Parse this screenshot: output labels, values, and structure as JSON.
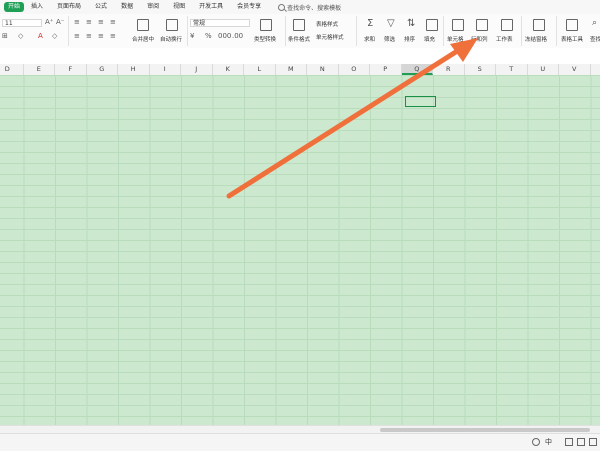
{
  "menu": {
    "active": "开始",
    "items": [
      "插入",
      "页面布局",
      "公式",
      "数据",
      "审阅",
      "视图",
      "开发工具",
      "会员专享"
    ],
    "search_placeholder": "查找命令、搜索模板"
  },
  "ribbon": {
    "font_size": "11",
    "number_format": "常规",
    "labels": {
      "merge": "合并居中",
      "wrap": "自动换行",
      "type_convert": "类型转换",
      "cond_format": "条件格式",
      "table_style": "表格样式",
      "cell_style": "单元格样式",
      "sum": "求和",
      "filter": "筛选",
      "sort": "排序",
      "fill": "填充",
      "cell": "单元格",
      "row_col": "行和列",
      "worksheet": "工作表",
      "freeze": "冻结窗格",
      "table_tools": "表格工具",
      "find": "查找"
    }
  },
  "columns": [
    "D",
    "E",
    "F",
    "G",
    "H",
    "I",
    "J",
    "K",
    "L",
    "M",
    "N",
    "O",
    "P",
    "Q",
    "R",
    "S",
    "T",
    "U",
    "V"
  ],
  "selected_column": "Q",
  "statusbar": {
    "zoom_label": "中"
  },
  "colors": {
    "accent": "#1f9e55",
    "sheet_bg": "#cce8cf",
    "arrow": "#f0703c"
  }
}
